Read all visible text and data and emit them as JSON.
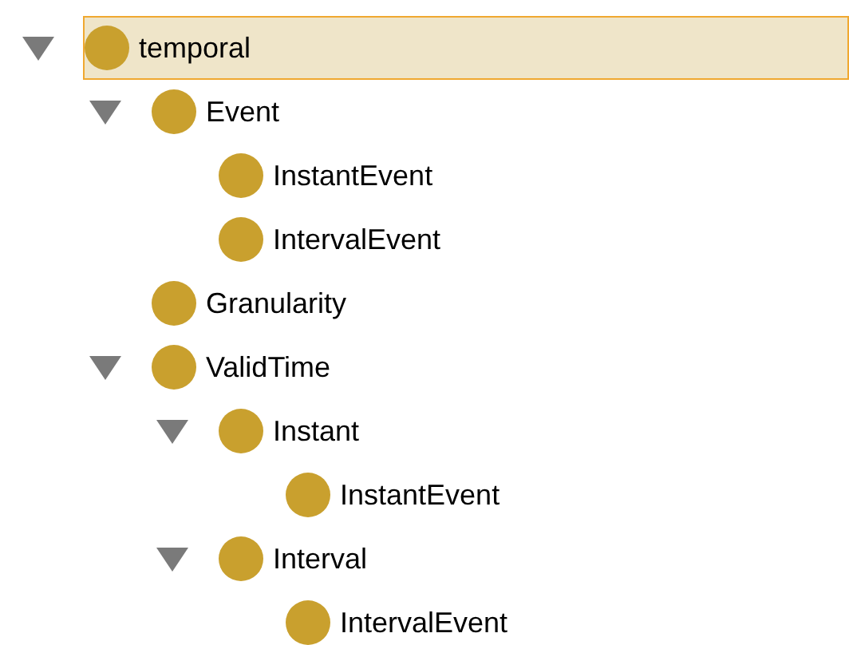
{
  "tree": [
    {
      "label": "temporal",
      "selected": true,
      "expanded": true,
      "children": [
        {
          "label": "Event",
          "selected": false,
          "expanded": true,
          "children": [
            {
              "label": "InstantEvent",
              "selected": false
            },
            {
              "label": "IntervalEvent",
              "selected": false
            }
          ]
        },
        {
          "label": "Granularity",
          "selected": false
        },
        {
          "label": "ValidTime",
          "selected": false,
          "expanded": true,
          "children": [
            {
              "label": "Instant",
              "selected": false,
              "expanded": true,
              "children": [
                {
                  "label": "InstantEvent",
                  "selected": false
                }
              ]
            },
            {
              "label": "Interval",
              "selected": false,
              "expanded": true,
              "children": [
                {
                  "label": "IntervalEvent",
                  "selected": false
                }
              ]
            }
          ]
        }
      ]
    }
  ]
}
